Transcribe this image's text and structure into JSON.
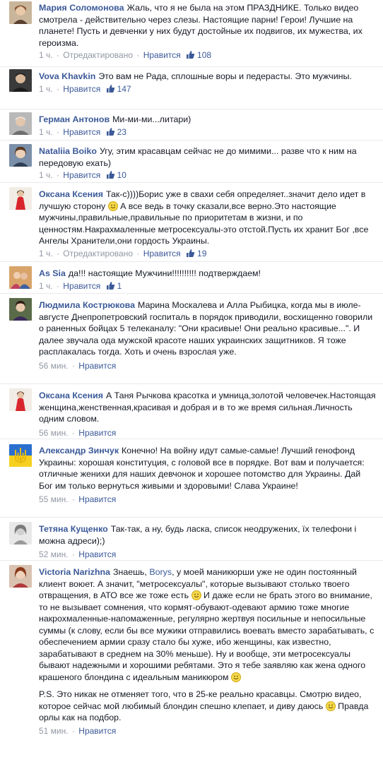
{
  "ui": {
    "like_label": "Нравится",
    "edited_label": "Отредактировано",
    "separator": "·"
  },
  "colors": {
    "link": "#3b5998",
    "meta": "#9197a3",
    "text": "#141823",
    "divider": "#e9eaed"
  },
  "comments": [
    {
      "author": "Мария Соломонова",
      "text": "Жаль, что я не была на этом ПРАЗДНИКЕ. Только видео смотрела - действительно через слезы. Настоящие парни! Герои! Лучшие на планете! Пусть и девченки у них будут достойные их подвигов, их мужества, их героизма.",
      "time": "1 ч.",
      "edited": true,
      "likes": "108",
      "avatar_icon": "woman-portrait-avatar"
    },
    {
      "author": "Vova Khavkin",
      "text": "Это вам не Рада, сплошные воры и педерасты. Это мужчины.",
      "time": "1 ч.",
      "edited": false,
      "likes": "147",
      "avatar_icon": "man-portrait-avatar"
    },
    {
      "author": "Герман Антонов",
      "text": "Ми-ми-ми...литари)",
      "time": "1 ч.",
      "edited": false,
      "likes": "23",
      "avatar_icon": "old-man-portrait-avatar"
    },
    {
      "author": "Nataliia Boiko",
      "text": "Угу, этим красавцам сейчас не до мимими... разве что к ним на передовую ехать)",
      "time": "1 ч.",
      "edited": false,
      "likes": "10",
      "avatar_icon": "woman-portrait-avatar"
    },
    {
      "author": "Оксана Ксения",
      "text_before_smiley": "Так-с))))Борис уже в свахи себя определяет..значит дело идет в лучшую сторону ",
      "text_after_smiley": " А все ведь в точку сказали,все верно.Это настоящие мужчины,правильные,правильные по приоритетам в жизни, и по ценностям.Накрахмаленные метросексуалы-это отстой.Пусть их хранит Бог ,все Ангелы Хранители,они гордость Украины.",
      "time": "1 ч.",
      "edited": true,
      "likes": "19",
      "avatar_icon": "woman-in-red-avatar"
    },
    {
      "author": "As Sia",
      "text": "да!!! настоящие Мужчини!!!!!!!!!! подтверждаем!",
      "time": "1 ч.",
      "edited": false,
      "likes": "1",
      "avatar_icon": "couple-photo-avatar"
    },
    {
      "author": "Людмила Кострюкова",
      "text": "Марина Москалева и Алла Рыбицка, когда мы в июле-августе Днепропетровский госпиталь в порядок приводили, восхищенно говорили о раненных бойцах 5 телеканалу: \"Они красивые! Они реально красивые...\". И далее звучала ода мужской красоте наших украинских защитников. Я тоже расплакалась тогда. Хоть и очень взрослая уже.",
      "time": "56 мин.",
      "edited": false,
      "likes": "",
      "avatar_icon": "woman-portrait-avatar"
    },
    {
      "author": "Оксана Ксения",
      "text": "А Таня Рычкова красотка и умница,золотой человечек.Настоящая женщина,женственная,красивая и добрая и в то же время сильная.Личность одним словом.",
      "time": "56 мин.",
      "edited": false,
      "likes": "",
      "avatar_icon": "woman-in-red-avatar"
    },
    {
      "author": "Александр Зинчук",
      "text": "Конечно! На войну идут самые-самые! Лучший генофонд Украины: хорошая конституция, с головой все в порядке. Вот вам и получается: отличные женихи для наших девчонок и хорошее потомство для Украины. Дай Бог им только вернуться живыми и здоровыми! Слава Украине!",
      "time": "55 мин.",
      "edited": false,
      "likes": "",
      "avatar_icon": "ukrainian-trident-avatar"
    },
    {
      "author": "Тетяна Кущенко",
      "text": "Так-так, а ну, будь ласка, список неодружених, їх телефони і можна адреси);)",
      "time": "52 мин.",
      "edited": false,
      "likes": "",
      "avatar_icon": "woman-sketch-avatar"
    },
    {
      "author": "Victoria Narizhna",
      "text_before_mention": "Знаешь, ",
      "mention": "Borys",
      "text_before_smiley": ", у моей маникюрши уже не один постоянный клиент воюет. А значит, \"метросексуалы\", которые вызывают столько твоего отвращения, в АТО все же тоже есть ",
      "text_after_smiley": " И даже если не брать этого во внимание, то не вызывает сомнения, что кормят-обувают-одевают армию тоже многие накрохмаленные-напомаженные, регулярно жертвуя посильные и непосильные суммы (к слову, если бы все мужики отправились воевать вместо зарабатывать, с обеспечением армии сразу стало бы хуже, ибо женщины, как известно, зарабатывают в среднем на 30% меньше). Ну и вообще, эти метросексуалы бывают надежными и хорошими ребятами. Это я тебе заявляю как жена одного крашеного блондина с идеальным маникюром ",
      "ps_before_smiley": "P.S. Это никак не отменяет того, что в 25-ке реально красавцы. Смотрю видео, которое сейчас мой любимый блондин спешно клепает, и диву даюсь ",
      "ps_after_smiley": " Правда орлы как на подбор.",
      "time": "51 мин.",
      "edited": false,
      "likes": "",
      "avatar_icon": "woman-portrait-avatar"
    }
  ]
}
